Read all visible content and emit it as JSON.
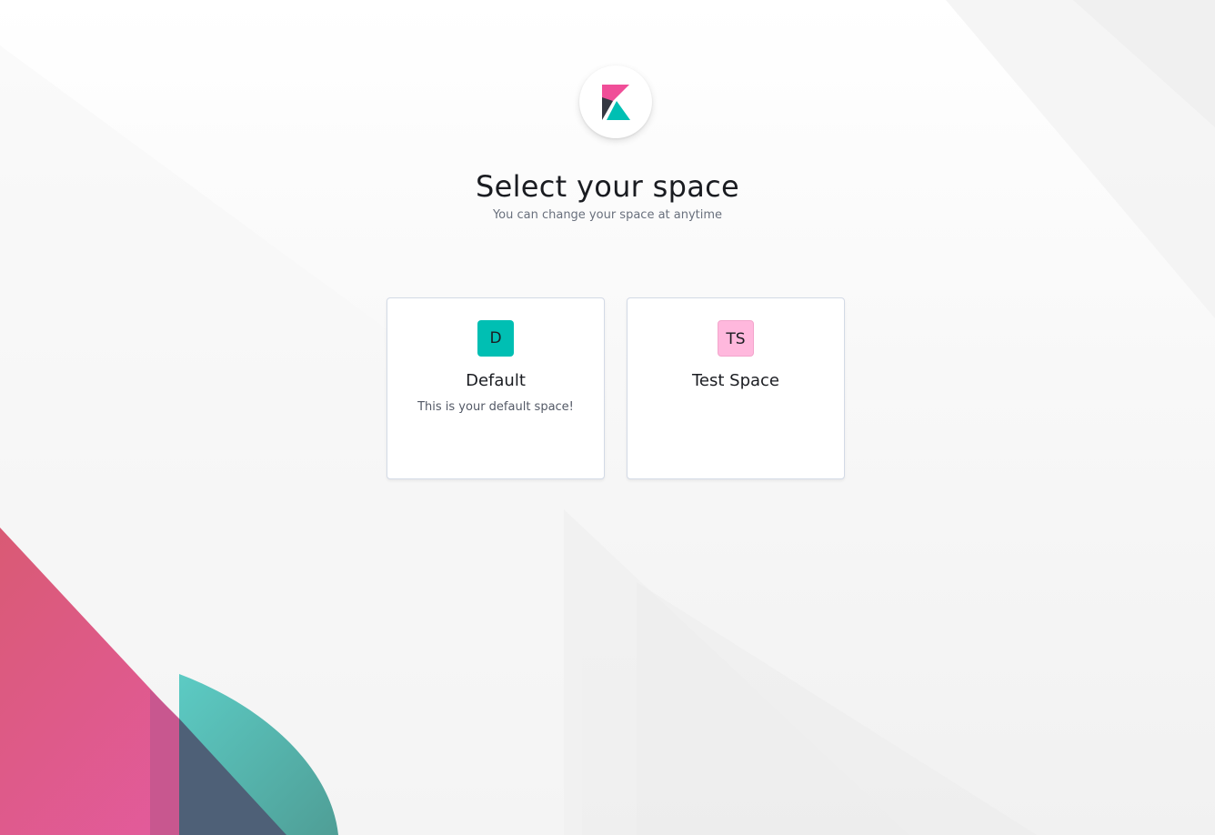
{
  "header": {
    "logo_icon": "kibana-logo-icon",
    "title": "Select your space",
    "subtitle": "You can change your space at anytime"
  },
  "spaces": [
    {
      "initials": "D",
      "name": "Default",
      "description": "This is your default space!",
      "avatar_color": "#00bfb3"
    },
    {
      "initials": "TS",
      "name": "Test Space",
      "description": "",
      "avatar_color": "#ffb8dd"
    }
  ],
  "colors": {
    "brand_pink": "#f04e98",
    "brand_teal": "#00bfb3",
    "brand_dark": "#343741"
  }
}
